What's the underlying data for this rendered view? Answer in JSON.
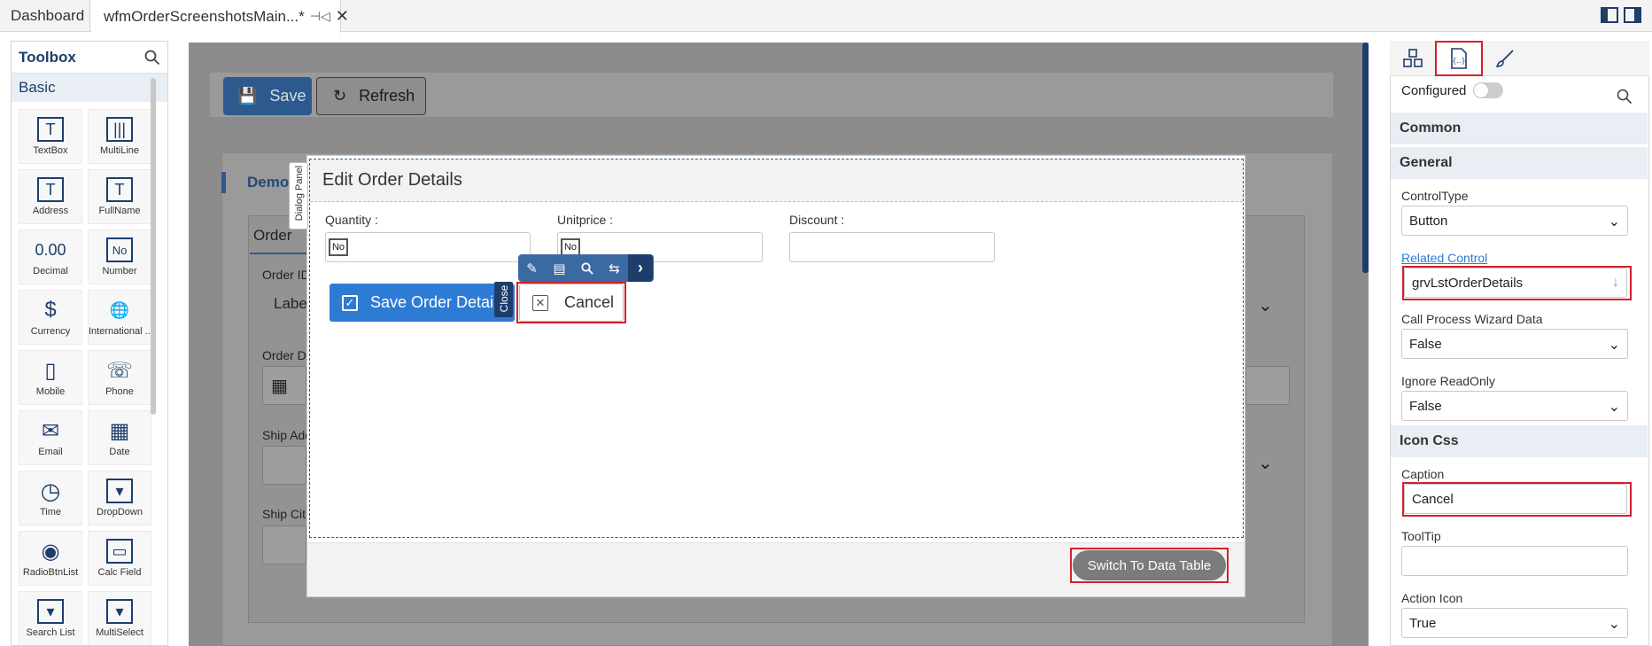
{
  "tabs": {
    "dashboard": "Dashboard",
    "active": "wfmOrderScreenshotsMain...",
    "active_modified": "*",
    "pin_icon": "pin-icon",
    "close_icon": "close-icon"
  },
  "toolbox": {
    "title": "Toolbox",
    "category": "Basic",
    "items": [
      {
        "label": "TextBox",
        "icon": "T"
      },
      {
        "label": "MultiLine",
        "icon": "|||"
      },
      {
        "label": "Address",
        "icon": "T"
      },
      {
        "label": "FullName",
        "icon": "T"
      },
      {
        "label": "Decimal",
        "icon": "0.00"
      },
      {
        "label": "Number",
        "icon": "No"
      },
      {
        "label": "Currency",
        "icon": "$"
      },
      {
        "label": "International ...",
        "icon": "🌐"
      },
      {
        "label": "Mobile",
        "icon": "▯"
      },
      {
        "label": "Phone",
        "icon": "☏"
      },
      {
        "label": "Email",
        "icon": "✉"
      },
      {
        "label": "Date",
        "icon": "▦"
      },
      {
        "label": "Time",
        "icon": "◷"
      },
      {
        "label": "DropDown",
        "icon": "▾"
      },
      {
        "label": "RadioBtnList",
        "icon": "◉"
      },
      {
        "label": "Calc Field",
        "icon": "▭"
      },
      {
        "label": "Search List",
        "icon": "▾"
      },
      {
        "label": "MultiSelect",
        "icon": "▾"
      }
    ]
  },
  "background": {
    "save_label": "Save",
    "refresh_label": "Refresh",
    "section_title": "Demo",
    "order_tab": "Order",
    "order_id_label": "Order ID",
    "labe_text": "Labe",
    "order_date_label": "Order Da",
    "ship_address_label": "Ship Add",
    "ship_city_label": "Ship Cit"
  },
  "dialog": {
    "panel_label": "Dialog Panel",
    "title": "Edit Order Details",
    "quantity_label": "Quantity :",
    "unitprice_label": "Unitprice :",
    "discount_label": "Discount :",
    "no_badge": "No",
    "save_button": "Save Order Details",
    "close_tag": "Close",
    "cancel_button": "Cancel",
    "switch_button": "Switch To Data Table"
  },
  "properties": {
    "configured_label": "Configured",
    "configured_on": false,
    "sections": {
      "common": "Common",
      "general": "General",
      "icon_css": "Icon Css"
    },
    "control_type_label": "ControlType",
    "control_type_value": "Button",
    "related_control_label": "Related Control",
    "related_control_value": "grvLstOrderDetails",
    "call_process_label": "Call Process Wizard Data",
    "call_process_value": "False",
    "ignore_readonly_label": "Ignore ReadOnly",
    "ignore_readonly_value": "False",
    "caption_label": "Caption",
    "caption_value": "Cancel",
    "tooltip_label": "ToolTip",
    "tooltip_value": "",
    "action_icon_label": "Action Icon",
    "action_icon_value": "True"
  },
  "colors": {
    "highlight": "#d4202b",
    "primary": "#2e7bd6",
    "navy": "#1d3d6b"
  }
}
